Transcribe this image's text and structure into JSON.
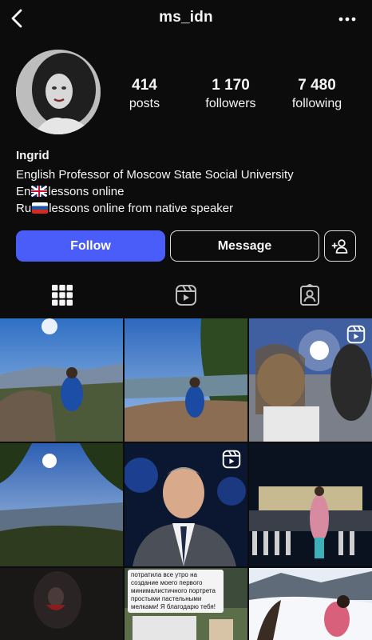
{
  "header": {
    "username": "ms_idn",
    "back_icon": "chevron-left-icon",
    "more_icon": "more-horizontal-icon"
  },
  "profile": {
    "stats": [
      {
        "value": "414",
        "label": "posts"
      },
      {
        "value": "1 170",
        "label": "followers"
      },
      {
        "value": "7 480",
        "label": "following"
      }
    ],
    "name": "Ingrid",
    "bio": {
      "line1": "English Professor of Moscow State Social University",
      "line2_prefix": "En",
      "line2_suffix": "lessons online",
      "line3_prefix": "Ru",
      "line3_suffix": "lessons online from native speaker"
    }
  },
  "actions": {
    "follow_label": "Follow",
    "message_label": "Message",
    "add_user_icon": "add-user-icon"
  },
  "tabs": [
    {
      "name": "posts-grid",
      "icon": "grid-icon",
      "active": true
    },
    {
      "name": "reels",
      "icon": "reels-icon",
      "active": false
    },
    {
      "name": "tagged",
      "icon": "tagged-user-icon",
      "active": false
    }
  ],
  "grid_posts": [
    {
      "kind": "photo",
      "reel": false
    },
    {
      "kind": "photo",
      "reel": false
    },
    {
      "kind": "video",
      "reel": true
    },
    {
      "kind": "photo",
      "reel": false
    },
    {
      "kind": "video",
      "reel": true
    },
    {
      "kind": "photo",
      "reel": false
    },
    {
      "kind": "photo",
      "reel": false
    },
    {
      "kind": "photo",
      "reel": false
    },
    {
      "kind": "photo",
      "reel": false
    }
  ],
  "post_8_caption": "потратила все утро на создание моего первого минималистичного портрета простыми пастельными мелками! Я благодарю тебя!",
  "colors": {
    "background": "#0c0c0c",
    "follow_button": "#4a5df9",
    "text": "#f5f5f5"
  }
}
